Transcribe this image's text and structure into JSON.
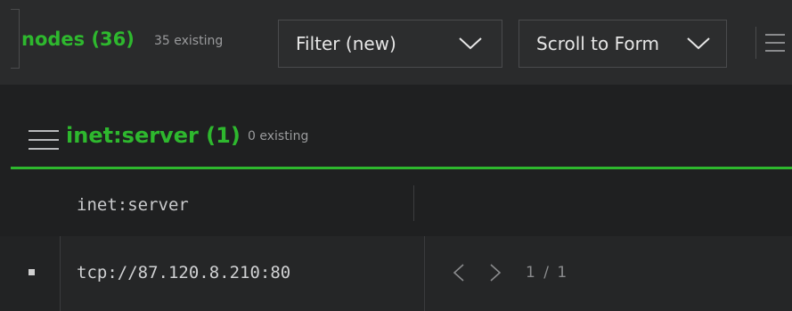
{
  "toolbar": {
    "nodes_label": "nodes (36)",
    "nodes_existing": "35 existing",
    "filter_label": "Filter (new)",
    "scroll_label": "Scroll to Form",
    "menu_icon": "hamburger-menu-icon",
    "chevron_icon": "chevron-down-icon"
  },
  "section": {
    "title": "inet:server (1)",
    "existing": "0 existing",
    "menu_icon": "hamburger-menu-icon"
  },
  "table": {
    "columns": [
      "inet:server"
    ],
    "rows": [
      {
        "value": "tcp://87.120.8.210:80"
      }
    ]
  },
  "pager": {
    "text": "1 / 1",
    "prev_icon": "chevron-left-icon",
    "next_icon": "chevron-right-icon"
  },
  "colors": {
    "accent": "#2eb82e",
    "background": "#1f2021",
    "toolbar_bg": "#2a2b2c",
    "muted_text": "#9a9b9d",
    "border": "#4a4b4d"
  }
}
